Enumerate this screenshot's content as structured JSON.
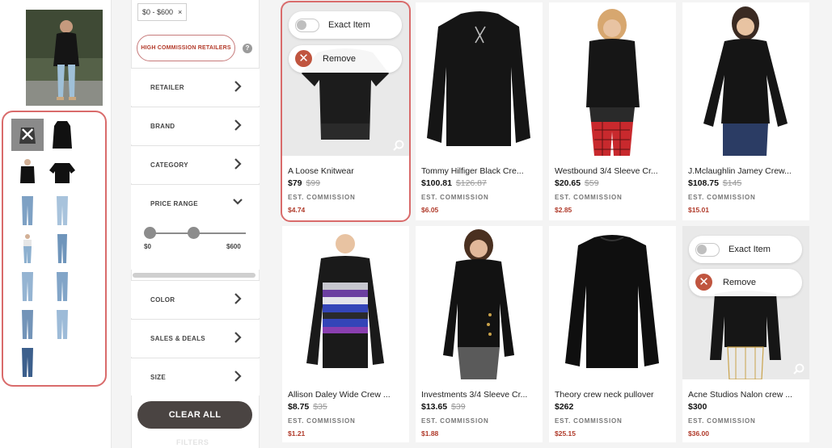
{
  "filters": {
    "price_chip": {
      "label": "$0 - $600",
      "close": "×"
    },
    "high_commission": "HIGH COMMISSION RETAILERS",
    "help": "?",
    "rows": [
      {
        "label": "RETAILER",
        "state": "collapsed"
      },
      {
        "label": "BRAND",
        "state": "collapsed"
      },
      {
        "label": "CATEGORY",
        "state": "collapsed"
      },
      {
        "label": "PRICE RANGE",
        "state": "expanded"
      },
      {
        "label": "COLOR",
        "state": "collapsed"
      },
      {
        "label": "SALES & DEALS",
        "state": "collapsed"
      },
      {
        "label": "SIZE",
        "state": "collapsed"
      }
    ],
    "price_min_label": "$0",
    "price_max_label": "$600",
    "price_selected_min": 0,
    "price_selected_max": 600,
    "clear_all": "CLEAR ALL",
    "filters_label": "FILTERS"
  },
  "overlay": {
    "exact_item": "Exact Item",
    "remove": "Remove",
    "est_label": "EST. COMMISSION"
  },
  "products": [
    {
      "name": "A Loose Knitwear",
      "price": "$79",
      "original": "$99",
      "commission": "$4.74"
    },
    {
      "name": "Tommy Hilfiger Black Cre...",
      "price": "$100.81",
      "original": "$126.87",
      "commission": "$6.05"
    },
    {
      "name": "Westbound 3/4 Sleeve Cr...",
      "price": "$20.65",
      "original": "$59",
      "commission": "$2.85"
    },
    {
      "name": "J.Mclaughlin Jamey Crew...",
      "price": "$108.75",
      "original": "$145",
      "commission": "$15.01"
    },
    {
      "name": "Allison Daley Wide Crew ...",
      "price": "$8.75",
      "original": "$35",
      "commission": "$1.21"
    },
    {
      "name": "Investments 3/4 Sleeve Cr...",
      "price": "$13.65",
      "original": "$39",
      "commission": "$1.88"
    },
    {
      "name": "Theory crew neck pullover",
      "price": "$262",
      "original": "",
      "commission": "$25.15"
    },
    {
      "name": "Acne Studios Nalon crew ...",
      "price": "$300",
      "original": "",
      "commission": "$36.00"
    }
  ],
  "colors": {
    "accent_red": "#d96b6b",
    "commission_red": "#b03a2a",
    "clear_button": "#4a4442",
    "remove_icon": "#c0553f"
  }
}
